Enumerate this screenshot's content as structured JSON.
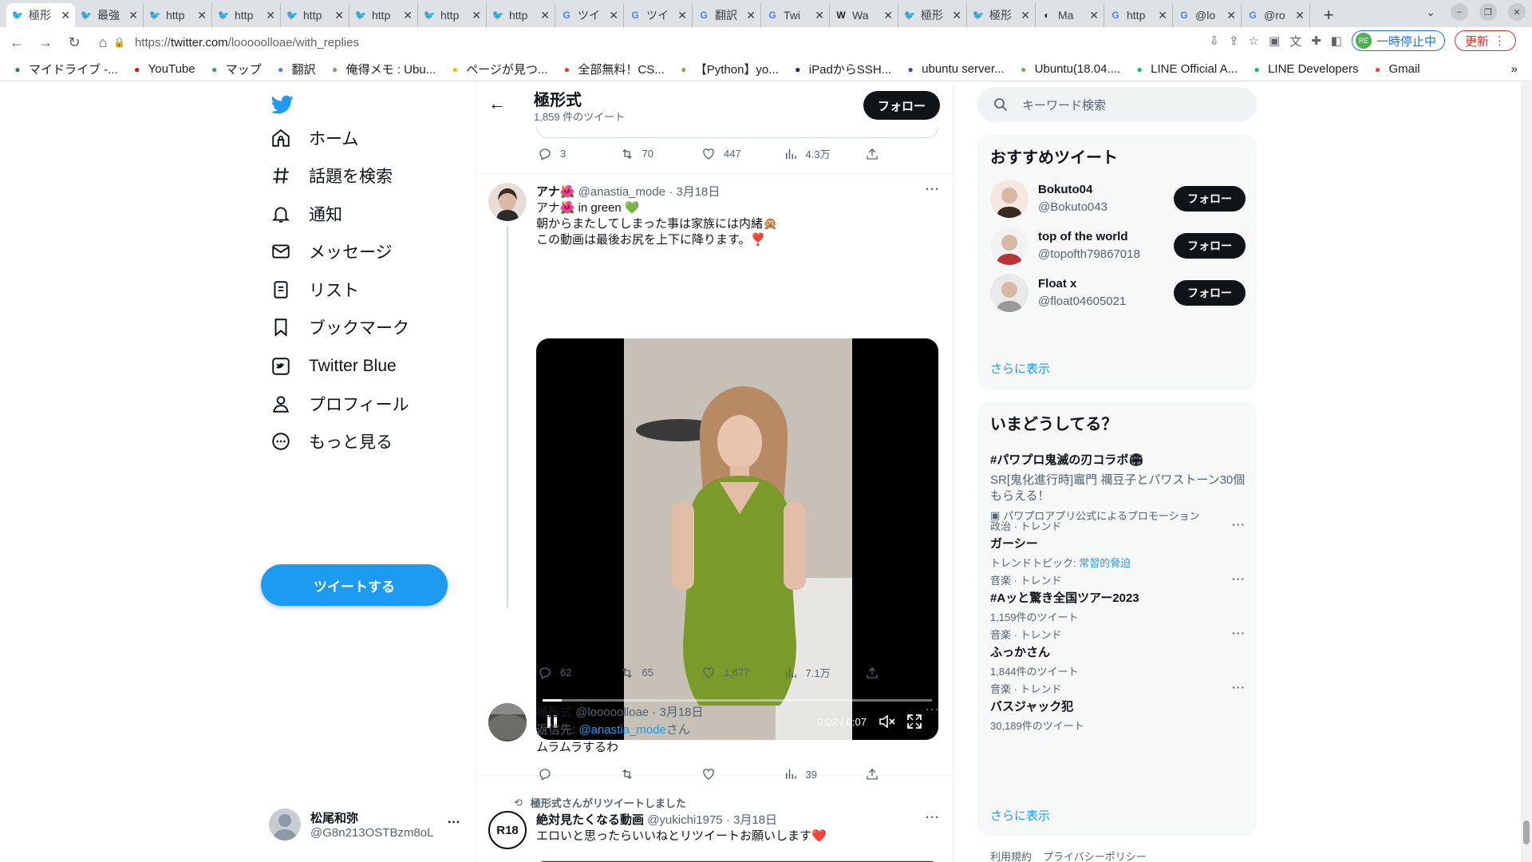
{
  "browser": {
    "tabs": [
      {
        "title": "極形",
        "icon": "twitter-icon",
        "active": true
      },
      {
        "title": "最強",
        "icon": "twitter-icon"
      },
      {
        "title": "http",
        "icon": "twitter-icon"
      },
      {
        "title": "http",
        "icon": "twitter-icon"
      },
      {
        "title": "http",
        "icon": "twitter-icon"
      },
      {
        "title": "http",
        "icon": "twitter-icon"
      },
      {
        "title": "http",
        "icon": "twitter-icon"
      },
      {
        "title": "http",
        "icon": "twitter-icon"
      },
      {
        "title": "ツイ",
        "icon": "google-icon"
      },
      {
        "title": "ツイ",
        "icon": "google-icon"
      },
      {
        "title": "翻訳",
        "icon": "google-icon"
      },
      {
        "title": "Twi",
        "icon": "google-icon"
      },
      {
        "title": "Wa",
        "icon": "wayback-icon"
      },
      {
        "title": "極形",
        "icon": "twitter-icon"
      },
      {
        "title": "極形",
        "icon": "twitter-icon"
      },
      {
        "title": "Ma",
        "icon": "github-icon"
      },
      {
        "title": "http",
        "icon": "google-icon"
      },
      {
        "title": "@lo",
        "icon": "google-icon"
      },
      {
        "title": "@ro",
        "icon": "google-icon"
      }
    ],
    "url_prefix": "https://",
    "url_host": "twitter.com",
    "url_path": "/looooolloae/with_replies",
    "pause_label": "一時停止中",
    "pause_avatar": "RE",
    "update_label": "更新",
    "bookmarks": [
      {
        "label": "マイドライブ -...",
        "icon": "drive-icon",
        "color": "#1e8e3e"
      },
      {
        "label": "YouTube",
        "icon": "youtube-icon",
        "color": "#ff0000"
      },
      {
        "label": "マップ",
        "icon": "maps-icon",
        "color": "#34a853"
      },
      {
        "label": "翻訳",
        "icon": "translate-icon",
        "color": "#4285f4"
      },
      {
        "label": "俺得メモ : Ubu...",
        "icon": "circle-icon",
        "color": "#7cb342"
      },
      {
        "label": "ページが見つ...",
        "icon": "drive-icon",
        "color": "#fbbc04"
      },
      {
        "label": "全部無料！CS...",
        "icon": "circle-icon",
        "color": "#e53935"
      },
      {
        "label": "【Python】yo...",
        "icon": "circle-icon",
        "color": "#7cb342"
      },
      {
        "label": "iPadからSSH...",
        "icon": "p-icon",
        "color": "#1a237e"
      },
      {
        "label": "ubuntu server...",
        "icon": "circle-icon",
        "color": "#5e35b1"
      },
      {
        "label": "Ubuntu(18.04....",
        "icon": "circle-icon",
        "color": "#7cb342"
      },
      {
        "label": "LINE Official A...",
        "icon": "line-icon",
        "color": "#06c755"
      },
      {
        "label": "LINE Developers",
        "icon": "line-icon",
        "color": "#06c755"
      },
      {
        "label": "Gmail",
        "icon": "google-icon",
        "color": "#ea4335"
      }
    ]
  },
  "nav": {
    "items": [
      {
        "label": "ホーム",
        "icon": "home-icon"
      },
      {
        "label": "話題を検索",
        "icon": "hashtag-icon"
      },
      {
        "label": "通知",
        "icon": "bell-icon"
      },
      {
        "label": "メッセージ",
        "icon": "mail-icon"
      },
      {
        "label": "リスト",
        "icon": "list-icon"
      },
      {
        "label": "ブックマーク",
        "icon": "bookmark-icon"
      },
      {
        "label": "Twitter Blue",
        "icon": "twitter-blue-icon"
      },
      {
        "label": "プロフィール",
        "icon": "profile-icon"
      },
      {
        "label": "もっと見る",
        "icon": "more-circle-icon"
      }
    ],
    "tweet_button": "ツイートする",
    "account_name": "松尾和弥",
    "account_handle": "@G8n213OSTBzm8oL"
  },
  "header": {
    "title": "極形式",
    "tweet_count": "1,859 件のツイート",
    "follow": "フォロー"
  },
  "tweets": {
    "prev_stats": {
      "replies": "3",
      "retweets": "70",
      "likes": "447",
      "views": "4.3万"
    },
    "t1": {
      "name": "アナ🌺",
      "handle": "@anastia_mode",
      "date": "· 3月18日",
      "line1": "アナ🌺 in green 💚",
      "line2": "朝からまたしてしまった事は家族には内緒🙊",
      "line3": "この動画は最後お尻を上下に降ります。❣️",
      "video_time": "0:02 / 0:07",
      "video_progress": 0.05,
      "stats": {
        "replies": "62",
        "retweets": "65",
        "likes": "1,677",
        "views": "7.1万"
      }
    },
    "t2": {
      "name": "極形式",
      "handle": "@looooolloae",
      "date": "· 3月18日",
      "reply_prefix": "返信先: ",
      "reply_to": "@anastia_mode",
      "reply_suffix": "さん",
      "text": "ムラムラするわ",
      "stats": {
        "views": "39"
      }
    },
    "t3": {
      "retweeted_by": "極形式さんがリツイートしました",
      "name": "絶対見たくなる動画",
      "handle": "@yukichi1975",
      "date": "· 3月18日",
      "text": "エロいと思ったらいいねとリツイートお願いします❤️",
      "avatar_text": "R18"
    }
  },
  "right": {
    "search_placeholder": "キーワード検索",
    "rec_title": "おすすめツイート",
    "recs": [
      {
        "name": "Bokuto04",
        "handle": "@Bokuto043",
        "follow": "フォロー"
      },
      {
        "name": "top of the world",
        "handle": "@topofth79867018",
        "follow": "フォロー"
      },
      {
        "name": "Float x",
        "handle": "@float04605021",
        "follow": "フォロー"
      }
    ],
    "show_more": "さらに表示",
    "trends_title": "いまどうしてる？",
    "promo": {
      "title": "#パワプロ鬼滅の刃コラボ🏟",
      "desc": "SR[鬼化進行時]竈門 禰豆子とパワストーン30個もらえる！",
      "by": "パワプロアプリ公式によるプロモーション"
    },
    "trends": [
      {
        "cat": "政治 · トレンド",
        "title": "ガーシー",
        "count_prefix": "トレンドトピック: ",
        "count_link": "常習的脅迫"
      },
      {
        "cat": "音楽 · トレンド",
        "title": "#Aッと驚き全国ツアー2023",
        "count": "1,159件のツイート"
      },
      {
        "cat": "音楽 · トレンド",
        "title": "ふっかさん",
        "count": "1,844件のツイート"
      },
      {
        "cat": "音楽 · トレンド",
        "title": "バスジャック犯",
        "count": "30,189件のツイート"
      }
    ],
    "footer": [
      "利用規約",
      "プライバシーポリシー"
    ]
  }
}
